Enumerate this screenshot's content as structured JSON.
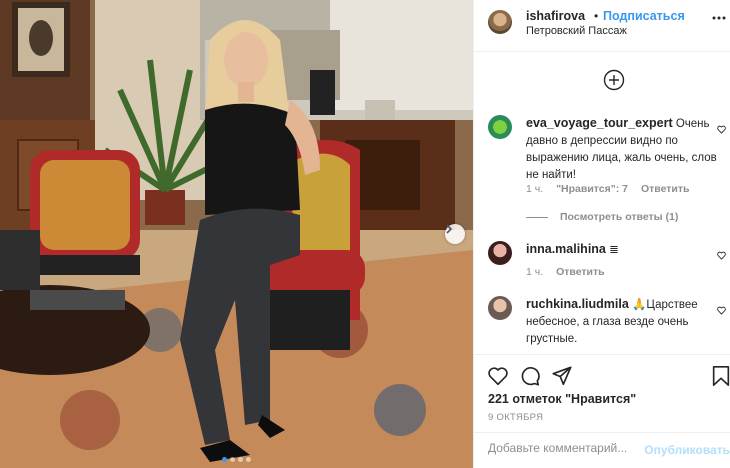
{
  "header": {
    "username": "ishafirova",
    "separator": "•",
    "follow_label": "Подписаться",
    "location": "Петровский Пассаж"
  },
  "comments": [
    {
      "username": "eva_voyage_tour_expert",
      "text": "Очень давно в депрессии видно по выражению лица, жаль очень, слов не найти!",
      "time": "1 ч.",
      "likes": "\"Нравится\": 7",
      "reply_label": "Ответить",
      "view_replies": "Посмотреть ответы (1)"
    },
    {
      "username": "inna.malihina",
      "text": "≣",
      "time": "1 ч.",
      "reply_label": "Ответить"
    },
    {
      "username": "ruchkina.liudmila",
      "text": "🙏Царствее небесное, а глаза везде очень грустные."
    }
  ],
  "actions": {
    "likes_count": "221 отметок \"Нравится\"",
    "date": "9 ОКТЯБРЯ"
  },
  "add_comment": {
    "placeholder": "Добавьте комментарий...",
    "publish_label": "Опубликовать"
  },
  "carousel": {
    "slides": 4,
    "active_index": 0
  },
  "colors": {
    "link_blue": "#3897f0",
    "publish_disabled": "#b2dffc",
    "meta_gray": "#8e8e8e"
  },
  "icons": [
    "chevron-right-icon",
    "plus-circle-icon",
    "heart-icon",
    "comment-icon",
    "share-icon",
    "bookmark-icon",
    "more-icon"
  ]
}
